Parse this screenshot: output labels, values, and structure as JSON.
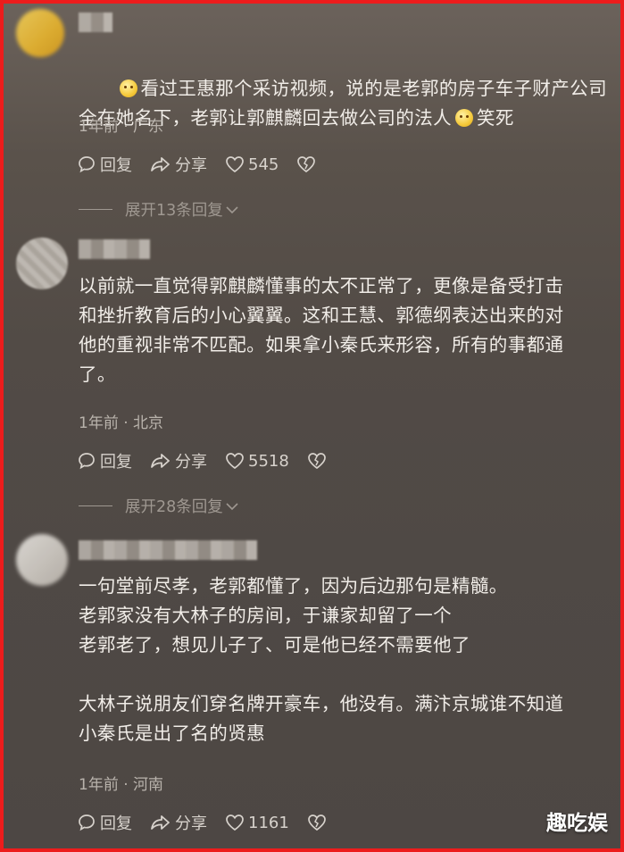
{
  "comments": [
    {
      "text_line1": "看过王惠那个采访视频，说的是老郭的房子车子财产公司",
      "text_line2_a": "全在她名下，老郭让郭麒麟回去做公司的法人",
      "text_line2_b": "笑死",
      "time_location": "1年前 · 广东",
      "reply_label": "回复",
      "share_label": "分享",
      "likes": "545",
      "expand_label": "展开13条回复"
    },
    {
      "text": "以前就一直觉得郭麒麟懂事的太不正常了，更像是备受打击\n和挫折教育后的小心翼翼。这和王慧、郭德纲表达出来的对\n他的重视非常不匹配。如果拿小秦氏来形容，所有的事都通\n了。",
      "time_location": "1年前 · 北京",
      "reply_label": "回复",
      "share_label": "分享",
      "likes": "5518",
      "expand_label": "展开28条回复"
    },
    {
      "text": "一句堂前尽孝，老郭都懂了，因为后边那句是精髓。\n老郭家没有大林子的房间，于谦家却留了一个\n老郭老了，想见儿子了、可是他已经不需要他了\n\n大林子说朋友们穿名牌开豪车，他没有。满汴京城谁不知道\n小秦氏是出了名的贤惠",
      "time_location": "1年前 · 河南",
      "reply_label": "回复",
      "share_label": "分享",
      "likes": "1161"
    }
  ],
  "watermark": "趣吃娱",
  "colors": {
    "border": "#ec1c1c",
    "text": "#f1ede8",
    "meta": "#b9b3ac"
  }
}
